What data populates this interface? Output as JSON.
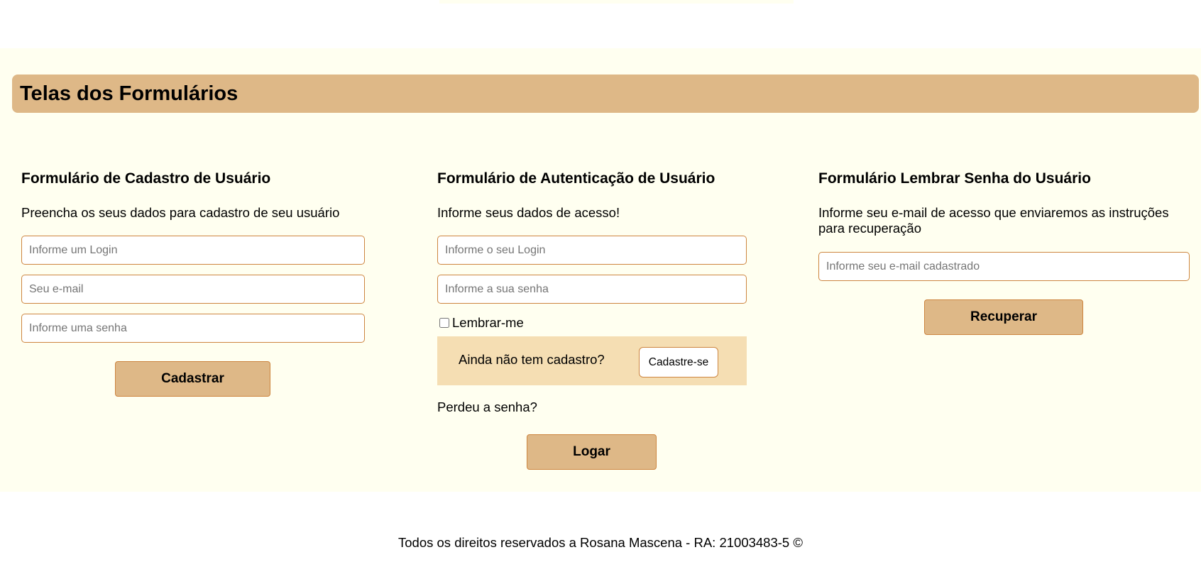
{
  "section_title": "Telas dos Formulários",
  "cadastro": {
    "title": "Formulário de Cadastro de Usuário",
    "description": "Preencha os seus dados para cadastro de seu usuário",
    "login_placeholder": "Informe um Login",
    "email_placeholder": "Seu e-mail",
    "senha_placeholder": "Informe uma senha",
    "button": "Cadastrar"
  },
  "autenticacao": {
    "title": "Formulário de Autenticação de Usuário",
    "description": "Informe seus dados de acesso!",
    "login_placeholder": "Informe o seu Login",
    "senha_placeholder": "Informe a sua senha",
    "remember_label": "Lembrar-me",
    "no_account_text": "Ainda não tem cadastro?",
    "signup_button": "Cadastre-se",
    "forgot_text": "Perdeu a senha?",
    "button": "Logar"
  },
  "lembrar": {
    "title": "Formulário Lembrar Senha do Usuário",
    "description": "Informe seu e-mail de acesso que enviaremos as instruções para recuperação",
    "email_placeholder": "Informe seu e-mail cadastrado",
    "button": "Recuperar"
  },
  "footer": "Todos os direitos reservados a Rosana Mascena - RA: 21003483-5 ©"
}
